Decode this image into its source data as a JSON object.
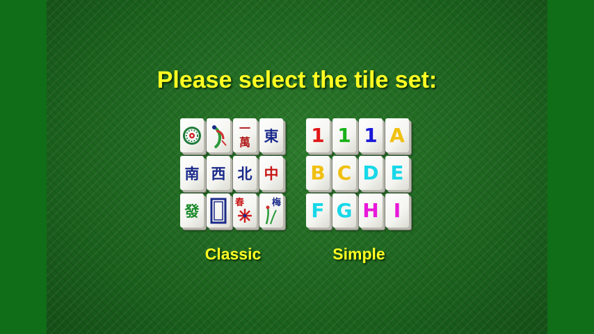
{
  "title": "Please select the tile set:",
  "tile_sets": [
    {
      "label": "Classic",
      "tiles": [
        {
          "glyph": "",
          "color": "#1a6a3a",
          "icon": "circle-dot-icon"
        },
        {
          "glyph": "",
          "color": "#2a9a3a",
          "icon": "bamboo-bird-icon"
        },
        {
          "glyph": "一\n萬",
          "color": "#b01818",
          "icon": ""
        },
        {
          "glyph": "東",
          "color": "#1a2a8a",
          "icon": ""
        },
        {
          "glyph": "南",
          "color": "#1a2a8a",
          "icon": ""
        },
        {
          "glyph": "西",
          "color": "#1a2a8a",
          "icon": ""
        },
        {
          "glyph": "北",
          "color": "#1a2a8a",
          "icon": ""
        },
        {
          "glyph": "中",
          "color": "#c81818",
          "icon": ""
        },
        {
          "glyph": "發",
          "color": "#1a8a2a",
          "icon": ""
        },
        {
          "glyph": "",
          "color": "#1a2a8a",
          "icon": "white-dragon-icon"
        },
        {
          "glyph": "春",
          "color": "#c81818",
          "icon": "spring-flower-icon"
        },
        {
          "glyph": "梅",
          "color": "#1a2a8a",
          "icon": "plum-flower-icon"
        }
      ]
    },
    {
      "label": "Simple",
      "tiles": [
        {
          "glyph": "1",
          "color": "#e01818"
        },
        {
          "glyph": "1",
          "color": "#18b018"
        },
        {
          "glyph": "1",
          "color": "#1818d8"
        },
        {
          "glyph": "A",
          "color": "#f0c010"
        },
        {
          "glyph": "B",
          "color": "#f0c010"
        },
        {
          "glyph": "C",
          "color": "#f0c010"
        },
        {
          "glyph": "D",
          "color": "#18d8e8"
        },
        {
          "glyph": "E",
          "color": "#18d8e8"
        },
        {
          "glyph": "F",
          "color": "#18d8e8"
        },
        {
          "glyph": "G",
          "color": "#18d8e8"
        },
        {
          "glyph": "H",
          "color": "#e818d8"
        },
        {
          "glyph": "I",
          "color": "#e818d8"
        }
      ]
    }
  ]
}
